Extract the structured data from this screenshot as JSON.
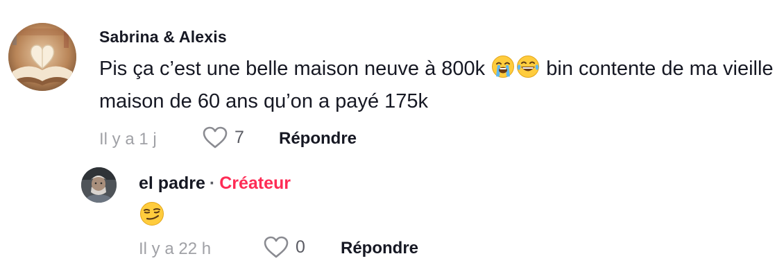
{
  "comments": [
    {
      "author": "Sabrina & Alexis",
      "text_before_emoji": "Pis ça c’est une belle maison neuve à 800k ",
      "emojis": [
        "loudly-crying-face",
        "face-with-tears-of-joy"
      ],
      "text_after_emoji": " bin contente de ma vieille maison de 60 ans qu’on a payé 175k",
      "time": "Il y a 1 j",
      "likes": "7",
      "reply_label": "Répondre",
      "avatar_icon": "heart-book-avatar",
      "replies": [
        {
          "author": "el padre",
          "separator": "·",
          "badge": "Créateur",
          "badge_color": "#fe2c55",
          "emoji": "smirking-face",
          "time": "Il y a 22 h",
          "likes": "0",
          "reply_label": "Répondre",
          "avatar_icon": "profile-photo-avatar"
        }
      ]
    }
  ],
  "icons": {
    "like": "heart-outline-icon"
  }
}
